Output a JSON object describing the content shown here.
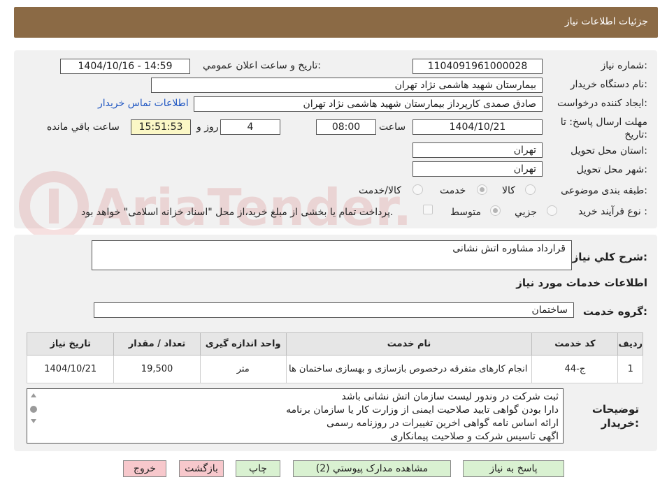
{
  "header": {
    "title": "جزئیات اطلاعات نیاز"
  },
  "form": {
    "need_number_label": "شماره نیاز:",
    "need_number": "1104091961000028",
    "announce_label": "تاریخ و ساعت اعلان عمومي:",
    "announce_value": "1404/10/16 - 14:59",
    "buyer_org_label": "نام دستگاه خریدار:",
    "buyer_org": "بیمارستان شهید هاشمی نژاد تهران",
    "requester_label": "ایجاد کننده درخواست:",
    "requester": "صادق صمدی کارپرداز بیمارستان شهید هاشمی نژاد تهران",
    "contact_link": "اطلاعات تماس خریدار",
    "deadline_label": "مهلت ارسال پاسخ: تا تاریخ:",
    "deadline_date": "1404/10/21",
    "time_label": "ساعت",
    "deadline_time": "08:00",
    "days_value": "4",
    "days_label": "روز و",
    "remaining_time": "15:51:53",
    "remaining_label": "ساعت باقي مانده",
    "province_label": "استان محل تحویل:",
    "province": "تهران",
    "city_label": "شهر محل تحویل:",
    "city": "تهران",
    "category_label": "طبقه بندی موضوعی:",
    "category_options": [
      "کالا",
      "خدمت",
      "کالا/خدمت"
    ],
    "category_selected": "خدمت",
    "process_label": "نوع فرآیند خرید :",
    "process_options": [
      "جزیي",
      "متوسط"
    ],
    "process_selected": "متوسط",
    "payment_note": "پرداخت تمام یا بخشی از مبلغ خرید،از محل \"اسناد خزانه اسلامی\" خواهد بود."
  },
  "watermark": "AriaTender.net",
  "summary": {
    "label": "شرح کلي نیاز:",
    "value": "قرارداد مشاوره اتش نشانی"
  },
  "services": {
    "section_title": "اطلاعات خدمات مورد نیاز",
    "group_label": "گروه خدمت:",
    "group_value": "ساختمان",
    "columns": [
      "ردیف",
      "کد خدمت",
      "نام خدمت",
      "واحد اندازه گیری",
      "تعداد / مقدار",
      "تاریخ نیاز"
    ],
    "rows": [
      {
        "row": "1",
        "code": "ج-44",
        "name": "انجام کارهای متفرقه درخصوص بازسازی و بهسازی ساختمان ها",
        "unit": "متر",
        "qty": "19,500",
        "date": "1404/10/21"
      }
    ]
  },
  "buyer_notes": {
    "label": "توضیحات خریدار:",
    "lines": [
      "ثبت شرکت در وندور لیست سازمان اتش نشانی باشد",
      "دارا بودن گواهی تایید صلاحیت ایمنی از وزارت کار یا سازمان برنامه",
      "ارائه اساس نامه گواهی اخرین تغییرات در روزنامه  رسمی",
      "اگهی تاسیس شرکت و صلاحیت پیمانکاری"
    ]
  },
  "buttons": {
    "reply": "پاسخ به نیاز",
    "attachments": "مشاهده مدارک پیوستي (2)",
    "print": "چاپ",
    "back": "بازگشت",
    "exit": "خروج"
  }
}
